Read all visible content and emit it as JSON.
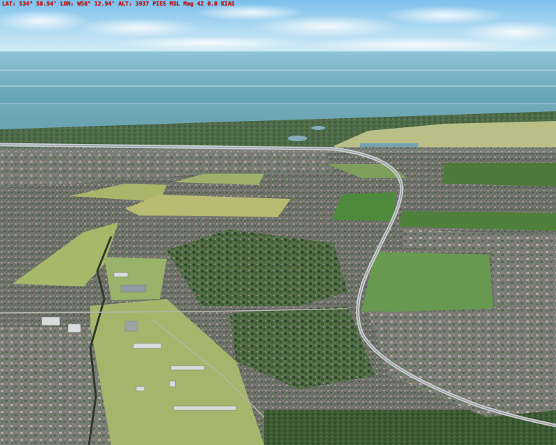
{
  "hud": {
    "lat": "LAT: S34° 50.94'",
    "lon": "LON: W58° 12.94'",
    "alt": "ALT: 3937 PIES MSL",
    "heading": "Mag 42",
    "speed": "0.0 KIAS",
    "color": "#e01818"
  },
  "scene": {
    "description_colors": {
      "sky": "#9fd0ee",
      "water": "#6aa7b8",
      "forest": "#3c5a34",
      "field": "#a9b66a",
      "urban": "#6d6f6a",
      "road": "#c9cdd0"
    }
  }
}
